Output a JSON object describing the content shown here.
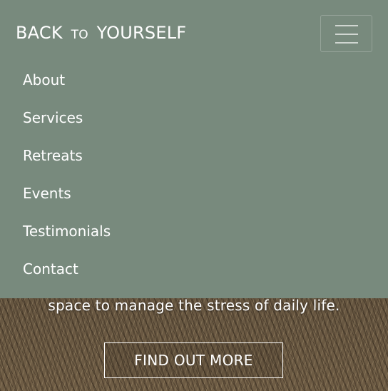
{
  "brand": {
    "part1": "BACK",
    "part2": "TO",
    "part3": "YOURSELF"
  },
  "toggler": {
    "icon": "hamburger-icon"
  },
  "menu": {
    "items": [
      {
        "label": "About"
      },
      {
        "label": "Services"
      },
      {
        "label": "Retreats"
      },
      {
        "label": "Events"
      },
      {
        "label": "Testimonials"
      },
      {
        "label": "Contact"
      }
    ]
  },
  "hero": {
    "text": "space to manage the stress of daily life.",
    "cta_label": "FIND OUT MORE"
  },
  "colors": {
    "navbar": "#788a7d",
    "text": "#ffffff"
  }
}
